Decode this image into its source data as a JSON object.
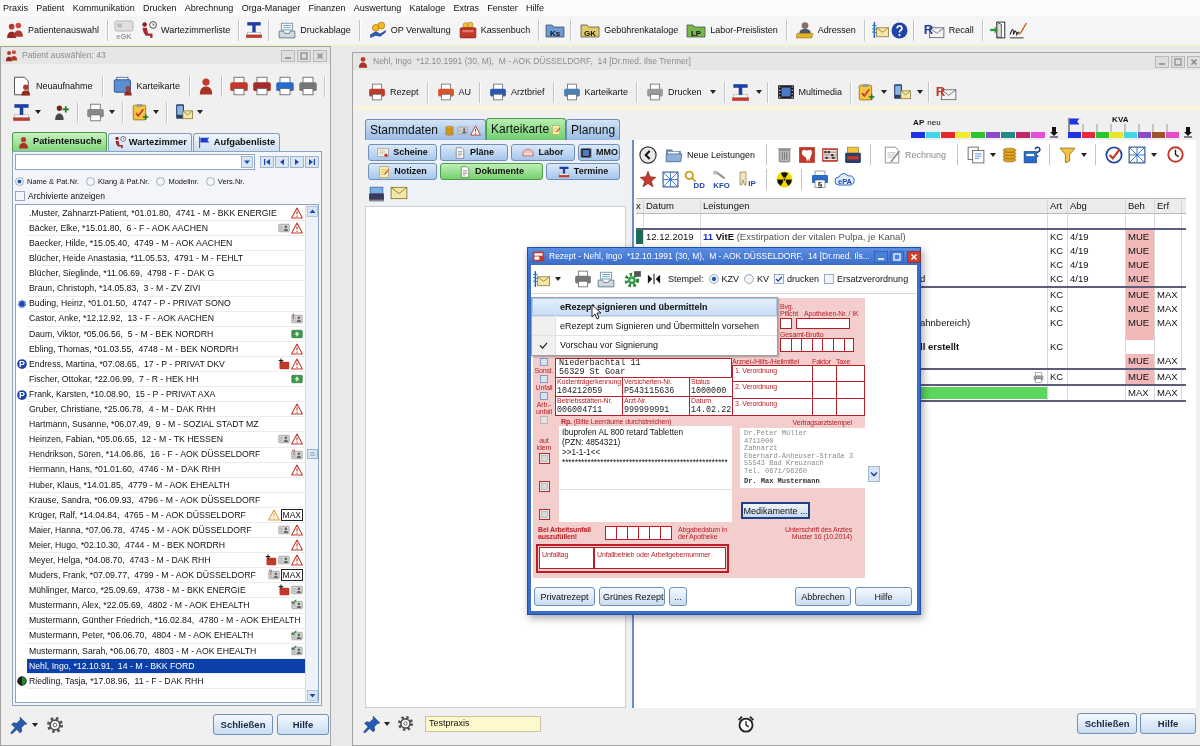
{
  "menu": [
    "Praxis",
    "Patient",
    "Kommunikation",
    "Drucken",
    "Abrechnung",
    "Orga-Manager",
    "Finanzen",
    "Auswertung",
    "Kataloge",
    "Extras",
    "Fenster",
    "Hilfe"
  ],
  "toolbar": {
    "buttons": [
      "Patientenauswahl",
      "Wartezimmerliste",
      "Druckablage",
      "OP Verwaltung",
      "Kassenbuch",
      "Gebührenkataloge",
      "Labor-Preislisten",
      "Adressen",
      "Recall"
    ],
    "card_caption": "eGK",
    "folder_letters": [
      "Ks",
      "GK",
      "LP"
    ],
    "recall_letter": "R"
  },
  "patient_window": {
    "title": "Patient auswählen: 43",
    "buttons": [
      "Neuaufnahme",
      "Karteikarte"
    ],
    "tabs": [
      {
        "label": "Patientensuche",
        "selected": true
      },
      {
        "label": "Wartezimmer",
        "selected": false
      },
      {
        "label": "Aufgabenliste",
        "selected": false
      }
    ],
    "search_modes": [
      {
        "label": "Name & Pat.Nr.",
        "selected": true
      },
      {
        "label": "Klang & Pat.Nr.",
        "selected": false
      },
      {
        "label": "Modellnr.",
        "selected": false
      },
      {
        "label": "Vers.Nr.",
        "selected": false
      }
    ],
    "archived": {
      "label": "Archivierte anzeigen",
      "checked": false
    },
    "patients": [
      {
        "text": ".Muster, Zahnarzt-Patient, *01.01.80,  4741 - M - BKK ENERGIE",
        "icons": [
          {
            "kind": "warning"
          }
        ],
        "selected": false
      },
      {
        "text": "Bäcker, Elke, *15.01.80,  6 - F - AOK AACHEN",
        "icons": [
          {
            "kind": "card"
          },
          {
            "kind": "warning"
          }
        ],
        "selected": false
      },
      {
        "text": "Baecker, Hilde, *15.05.40,  4749 - M - AOK AACHEN",
        "selected": false
      },
      {
        "text": "Blücher, Heide Anastasia, *11.05.53,  4791 - M - FEHLT",
        "selected": false
      },
      {
        "text": "Blücher, Sieglinde, *11.06.69,  4798 - F - DAK G",
        "selected": false
      },
      {
        "text": "Braun, Christoph, *14.05.83,  3 - M - ZV ZIVI",
        "selected": false
      },
      {
        "text": "Buding, Heinz, *01.01.50,  4747 - P - PRIVAT SONO",
        "marker": {
          "kind": "gear"
        },
        "selected": false
      },
      {
        "text": "Castor, Anke, *12.12.92,  13 - F - AOK AACHEN",
        "icons": [
          {
            "kind": "card-alert"
          }
        ],
        "selected": false
      },
      {
        "text": "Daum, Viktor, *05.06.56,  5 - M - BEK NORDRH",
        "icons": [
          {
            "kind": "card-plus"
          }
        ],
        "selected": false
      },
      {
        "text": "Ebling, Thomas, *01.03.55,  4748 - M - BEK NORDRH",
        "icons": [
          {
            "kind": "warning"
          }
        ],
        "selected": false
      },
      {
        "text": "Endress, Martina, *07.08.65,  17 - P - PRIVAT DKV",
        "marker": {
          "kind": "letter",
          "text": "P"
        },
        "icons": [
          {
            "kind": "bag-plus"
          },
          {
            "kind": "warning"
          }
        ],
        "selected": false
      },
      {
        "text": "Fischer, Ottokar, *22.06.99,  7 - R - HEK HH",
        "icons": [
          {
            "kind": "card-plus"
          }
        ],
        "selected": false
      },
      {
        "text": "Frank, Karsten, *10.08.90,  15 - P - PRIVAT AXA",
        "marker": {
          "kind": "letter",
          "text": "P"
        },
        "selected": false
      },
      {
        "text": "Gruber, Christiane, *25.06.78,  4 - M - DAK RHH",
        "icons": [
          {
            "kind": "warning"
          }
        ],
        "selected": false
      },
      {
        "text": "Hartmann, Susanne, *06.07.49,  9 - M - SOZIAL STADT MZ",
        "selected": false
      },
      {
        "text": "Heinzen, Fabian, *05.06.65,  12 - M - TK HESSEN",
        "icons": [
          {
            "kind": "card"
          },
          {
            "kind": "warning"
          }
        ],
        "selected": false
      },
      {
        "text": "Hendrikson, Sören, *14.06.86,  16 - F - AOK DÜSSELDORF",
        "icons": [
          {
            "kind": "card-question"
          }
        ],
        "selected": false
      },
      {
        "text": "Hermann, Hans, *01.01.60,  4746 - M - DAK RHH",
        "icons": [
          {
            "kind": "warning"
          }
        ],
        "selected": false
      },
      {
        "text": "Huber, Klaus, *14.01.85,  4779 - M - AOK EHEALTH",
        "selected": false
      },
      {
        "text": "Krause, Sandra, *06.09.93,  4796 - M - AOK DÜSSELDORF",
        "selected": false
      },
      {
        "text": "Krüger, Ralf, *14.04.84,  4765 - M - AOK DÜSSELDORF",
        "icons": [
          {
            "kind": "warning-outline"
          }
        ],
        "tag": "MAX",
        "selected": false
      },
      {
        "text": "Maier, Hanna, *07.06.78,  4745 - M - AOK DÜSSELDORF",
        "icons": [
          {
            "kind": "card"
          },
          {
            "kind": "warning"
          }
        ],
        "selected": false
      },
      {
        "text": "Meier, Hugo, *02.10.30,  4744 - M - BEK NORDRH",
        "icons": [
          {
            "kind": "warning"
          }
        ],
        "selected": false
      },
      {
        "text": "Meyer, Helga, *04.08.70,  4743 - M - DAK RHH",
        "icons": [
          {
            "kind": "bag-plus"
          },
          {
            "kind": "card"
          },
          {
            "kind": "warning"
          }
        ],
        "selected": false
      },
      {
        "text": "Muders, Frank, *07.09.77,  4799 - M - AOK DÜSSELDORF",
        "icons": [
          {
            "kind": "card-question"
          }
        ],
        "tag": "MAX",
        "selected": false
      },
      {
        "text": "Mühlinger, Marco, *25.09.69,  4738 - M - BKK ENERGIE",
        "icons": [
          {
            "kind": "bag-plus"
          },
          {
            "kind": "card"
          }
        ],
        "selected": false
      },
      {
        "text": "Mustermann, Alex, *22.05.69,  4802 - M - AOK EHEALTH",
        "icons": [
          {
            "kind": "card-check"
          }
        ],
        "selected": false
      },
      {
        "text": "Mustermann, Günther Friedrich, *16.02.84,  4780 - M - AOK EHEALTH",
        "selected": false
      },
      {
        "text": "Mustermann, Peter, *06.06.70,  4804 - M - AOK EHEALTH",
        "icons": [
          {
            "kind": "card-check"
          }
        ],
        "selected": false
      },
      {
        "text": "Mustermann, Sarah, *06.06.70,  4803 - M - AOK EHEALTH",
        "icons": [
          {
            "kind": "card-check"
          }
        ],
        "selected": false
      },
      {
        "text": "Nehl, Ingo, *12.10.91,  14 - M - BKK FORD",
        "selected": true
      },
      {
        "text": "Riedling, Tasja, *17.08.96,  11 - F - DAK RHH",
        "marker": {
          "kind": "half"
        },
        "selected": false
      }
    ],
    "footer_buttons": [
      "Schließen",
      "Hilfe"
    ]
  },
  "record_window": {
    "title": "Nehl, Ingo  *12.10.1991 (30, M),  M - AOK DÜSSELDORF,  14 [Dr.med. Ilse Trenner]",
    "toolbar": [
      "Rezept",
      "AU",
      "Arztbrief",
      "Karteikarte",
      "Drucken",
      "Multimedia"
    ],
    "r_letter": "R",
    "tabs": [
      {
        "label": "Stammdaten",
        "selected": false
      },
      {
        "label": "Karteikarte",
        "selected": true
      },
      {
        "label": "Planung",
        "selected": false
      }
    ],
    "legend": {
      "ap": "AP",
      "neu": "neu",
      "kva": "KVA",
      "ap_segments": [
        {
          "color": "#1e32e6"
        },
        {
          "color": "#3fd6e8"
        },
        {
          "color": "#e62828"
        },
        {
          "color": "#f2ea2a"
        },
        {
          "color": "#2cc42c"
        },
        {
          "color": "#8a4cc8"
        },
        {
          "color": "#1f8a8a"
        },
        {
          "color": "#c02868"
        },
        {
          "color": "#e64ce0"
        }
      ],
      "kva_segments": [
        {
          "color": "#1e32e6"
        },
        {
          "color": "#e62840"
        },
        {
          "color": "#2cc42c"
        },
        {
          "color": "#e6e628"
        },
        {
          "color": "#3fd6e8"
        },
        {
          "color": "#8a4cc8"
        },
        {
          "color": "#a0522d"
        },
        {
          "color": "#e64cc8"
        }
      ]
    },
    "subtabs": [
      {
        "label": "Scheine",
        "selected": false
      },
      {
        "label": "Pläne",
        "selected": false
      },
      {
        "label": "Labor",
        "selected": false
      },
      {
        "label": "MMO",
        "selected": false
      },
      {
        "label": "Notizen",
        "selected": false
      },
      {
        "label": "Dokumente",
        "selected": true
      },
      {
        "label": "Termine",
        "selected": false
      }
    ],
    "actions": {
      "new_entries": "Neue Leistungen",
      "invoice": {
        "label": "Rechnung",
        "disabled": true
      },
      "icon_letters": [
        "DD",
        "KFO",
        "IP",
        "§",
        "ePA"
      ]
    },
    "table": {
      "columns": [
        "x",
        "Datum",
        "Leistungen",
        "Art",
        "Abg",
        "Beh",
        "Erf"
      ],
      "rows": [
        {
          "kind": "empty",
          "group_end": true
        },
        {
          "kind": "entry",
          "color": "#1e6a5a",
          "date": "12.12.2019",
          "number": "11",
          "code": "VitE",
          "description": "(Exstirpation der vitalen Pulpa, je Kanal)",
          "art": "KC",
          "abg": "4/19",
          "beh": "MUE",
          "beh_marked": true,
          "attachment": false,
          "wrapped": false,
          "group_end": false
        },
        {
          "kind": "covered",
          "art": "KC",
          "abg": "4/19",
          "beh": "MUE",
          "beh_marked": true,
          "attachment": false,
          "wrapped": false,
          "group_end": false
        },
        {
          "kind": "covered",
          "art": "KC",
          "abg": "4/19",
          "beh": "MUE",
          "beh_marked": true,
          "attachment": false,
          "wrapped": false,
          "group_end": false
        },
        {
          "kind": "covered",
          "tail": "d",
          "art": "KC",
          "abg": "4/19",
          "beh": "MUE",
          "beh_marked": true,
          "attachment": false,
          "wrapped": false,
          "group_end": true
        },
        {
          "kind": "covered",
          "art": "KC",
          "beh": "MUE",
          "beh_marked": true,
          "erf": "MAX",
          "attachment": false,
          "wrapped": false,
          "group_end": false
        },
        {
          "kind": "covered",
          "art": "KC",
          "beh": "MUE",
          "beh_marked": true,
          "erf": "MAX",
          "attachment": false,
          "wrapped": false,
          "group_end": false
        },
        {
          "kind": "covered",
          "tail": "ahnbereich)",
          "art": "KC",
          "beh": "MUE",
          "beh_marked": true,
          "erf": "MAX",
          "attachment": false,
          "wrapped": true,
          "group_end": false
        },
        {
          "kind": "note",
          "tail": "ll erstellt",
          "art": "KC",
          "attachment": false,
          "wrapped": false,
          "group_end": false
        },
        {
          "kind": "covered",
          "beh": "MUE",
          "beh_marked": true,
          "erf": "MAX",
          "attachment": false,
          "wrapped": false,
          "group_end": true
        },
        {
          "kind": "covered",
          "art": "KC",
          "beh": "MUE",
          "beh_marked": true,
          "erf": "MAX",
          "attachment": true,
          "wrapped": false,
          "group_end": true
        },
        {
          "kind": "bar",
          "color": "#5cd65c",
          "beh": "MAX",
          "beh_marked": false,
          "erf": "MAX",
          "attachment": false,
          "wrapped": false,
          "group_end": true
        }
      ]
    },
    "practice": {
      "value": "Testpraxis"
    },
    "footer_buttons": [
      "Schließen",
      "Hilfe"
    ]
  },
  "rezept_dialog": {
    "title": "Rezept - Nehl, Ingo  *12.10.1991 (30, M),  M - AOK DÜSSELDORF,  14 [Dr.med. Ils...",
    "stamp_label": "Stempel:",
    "stamp_options": [
      {
        "label": "KZV",
        "selected": true
      },
      {
        "label": "KV",
        "selected": false
      }
    ],
    "options": [
      {
        "label": "drucken",
        "checked": true
      },
      {
        "label": "Ersatzverordnung",
        "checked": false
      }
    ],
    "menu": [
      {
        "label": "eRezept signieren und übermitteln",
        "selected": true,
        "default": true,
        "checked": false
      },
      {
        "label": "eRezept zum Signieren und Übermitteln vorsehen",
        "selected": false,
        "default": false,
        "checked": false
      },
      {
        "label": "Vorschau vor Signierung",
        "selected": false,
        "default": false,
        "checked": true
      }
    ],
    "form": {
      "pharmacy_labels": [
        "Bvg. Pflicht",
        "Apotheken-Nr. / IK",
        "Gesamt-Brutto"
      ],
      "address": [
        "Niederbachtal 11",
        "56329 St Goar"
      ],
      "fields": [
        {
          "label": "Kostenträgerkennung",
          "value": "104212059"
        },
        {
          "label": "Versicherten-Nr.",
          "value": "P543115636"
        },
        {
          "label": "Status",
          "value": "1000000"
        },
        {
          "label": "Betriebsstätten-Nr.",
          "value": "006004711"
        },
        {
          "label": "Arzt-Nr.",
          "value": "999999991"
        },
        {
          "label": "Datum",
          "value": "14.02.22"
        }
      ],
      "item_header": [
        "Arznei-/Hilfs-/Heilmittel",
        "Faktor",
        "Taxe"
      ],
      "orders": [
        "1. Verordnung",
        "2. Verordnung",
        "3. Verordnung"
      ],
      "side_boxes": [
        {
          "label": "Sonst.",
          "checked": false,
          "disabled": false
        },
        {
          "label": "Unfall",
          "checked": false,
          "disabled": false
        },
        {
          "label": "Arb.- unfall",
          "checked": false,
          "disabled": false
        },
        {
          "checked": false,
          "disabled": true
        }
      ],
      "aut_idem": {
        "label": "aut idem",
        "boxes": [
          {
            "checked": false
          },
          {
            "checked": false
          },
          {
            "checked": false
          }
        ]
      },
      "rp_label": "**Rp.** (Bitte Leerräume durchstreichen)",
      "prescription": [
        "Ibuprofen AL 800 retard Tabletten",
        "(PZN: 4854321)",
        ">>1-1-1<<",
        "****************************************************"
      ],
      "stamp_label": "Vertragsarztstempel",
      "stamp": [
        "Dr.Peter Müller",
        "4711000",
        "Zahnarzt",
        "Eberhard-Anheuser-Straße 3",
        "55543 Bad Kreuznach",
        "Tel. 0671/96260"
      ],
      "stamp_signature": "Dr. Max Mustermann",
      "medication_button": "Medikamente ...",
      "accident_note": "Bei Arbeitsunfall auszufüllen!",
      "dispense_label": "Abgabedatum in der Apotheke",
      "signature_label": "Unterschrift des Arztes",
      "form_id": "Muster 16 (10.2014)",
      "accident_fields": [
        "Unfalltag",
        "Unfallbetrieb oder Arbeitgebernummer"
      ]
    },
    "buttons_left": [
      "Privatrezept",
      "Grünes Rezept",
      "..."
    ],
    "buttons_right": [
      "Abbrechen",
      "Hilfe"
    ]
  }
}
